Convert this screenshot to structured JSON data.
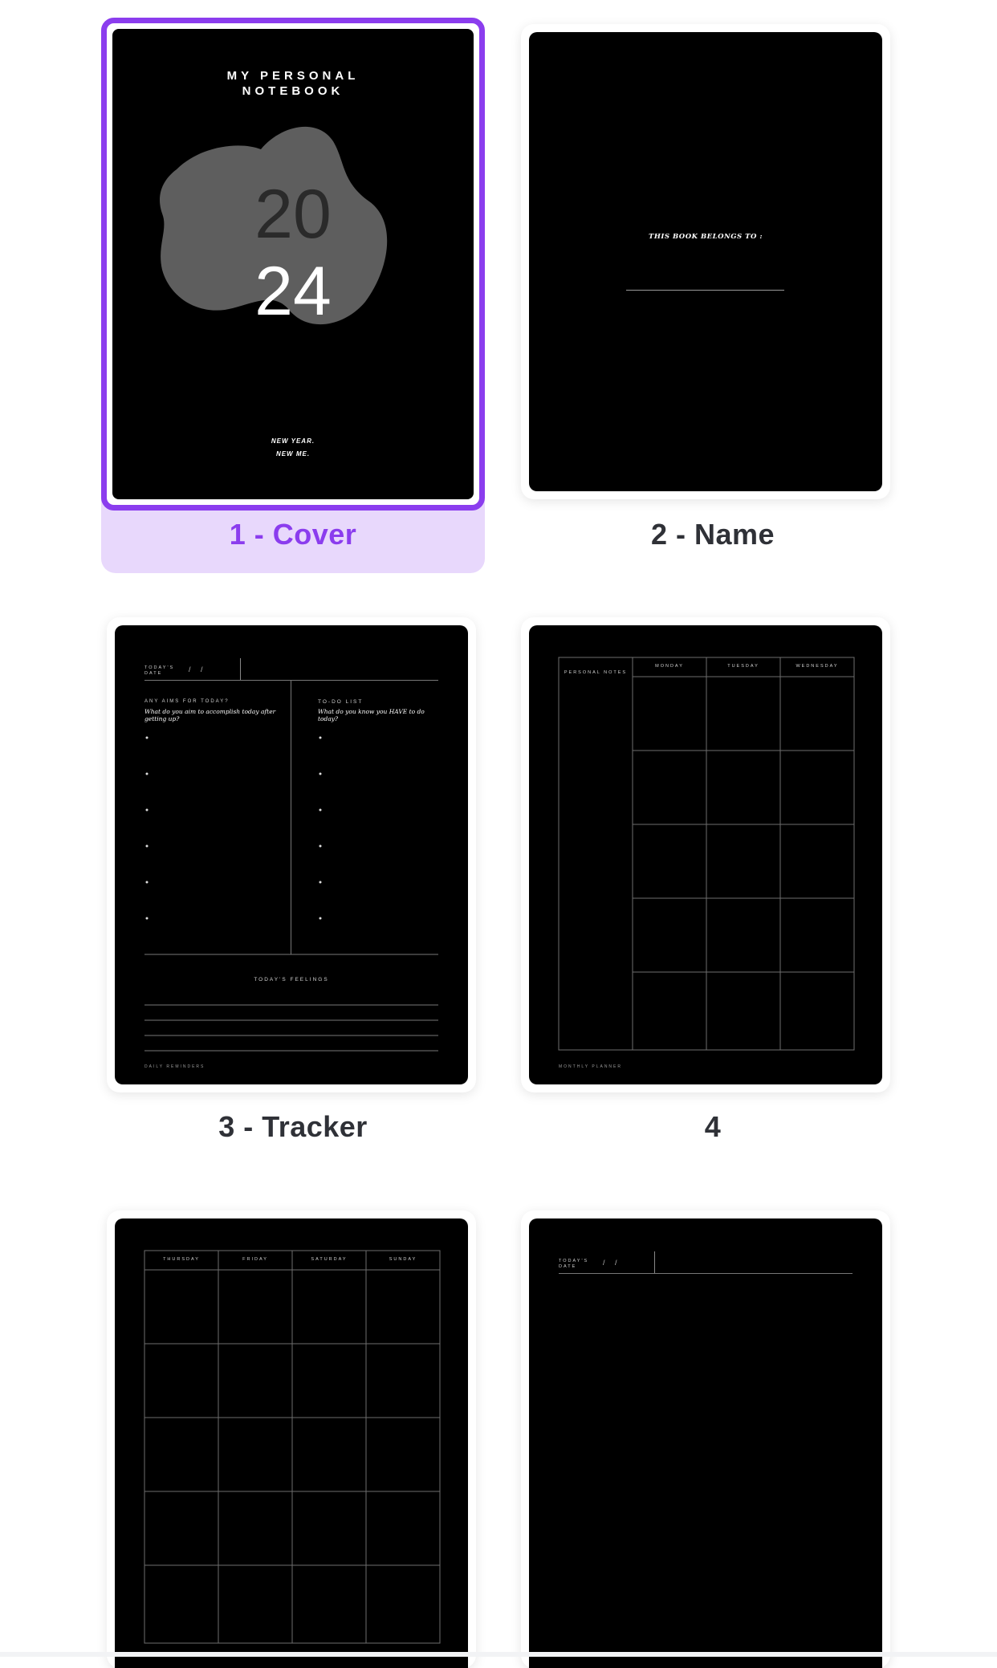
{
  "pages": [
    {
      "label": "1 - Cover",
      "selected": true,
      "cover": {
        "title_line1": "MY PERSONAL",
        "title_line2": "NOTEBOOK",
        "year_top": "20",
        "year_bottom": "24",
        "tagline_line1": "NEW YEAR.",
        "tagline_line2": "NEW ME."
      }
    },
    {
      "label": "2 - Name",
      "name_page": {
        "text": "THIS BOOK BELONGS TO :"
      }
    },
    {
      "label": "3 - Tracker",
      "tracker": {
        "date_label": "TODAY'S DATE",
        "aims_heading": "ANY AIMS FOR TODAY?",
        "aims_question": "What do you aim to accomplish today after getting up?",
        "todo_heading": "TO-DO LIST",
        "todo_question": "What do you know you HAVE to do today?",
        "feelings_heading": "TODAY'S FEELINGS",
        "reminders_label": "DAILY REMINDERS"
      }
    },
    {
      "label": "4",
      "planner": {
        "notes_label": "PERSONAL NOTES",
        "days": [
          "MONDAY",
          "TUESDAY",
          "WEDNESDAY"
        ],
        "footer": "MONTHLY PLANNER"
      }
    },
    {
      "planner2": {
        "days": [
          "THURSDAY",
          "FRIDAY",
          "SATURDAY",
          "SUNDAY"
        ]
      }
    },
    {
      "notes": {
        "date_label": "TODAY'S DATE"
      }
    }
  ]
}
